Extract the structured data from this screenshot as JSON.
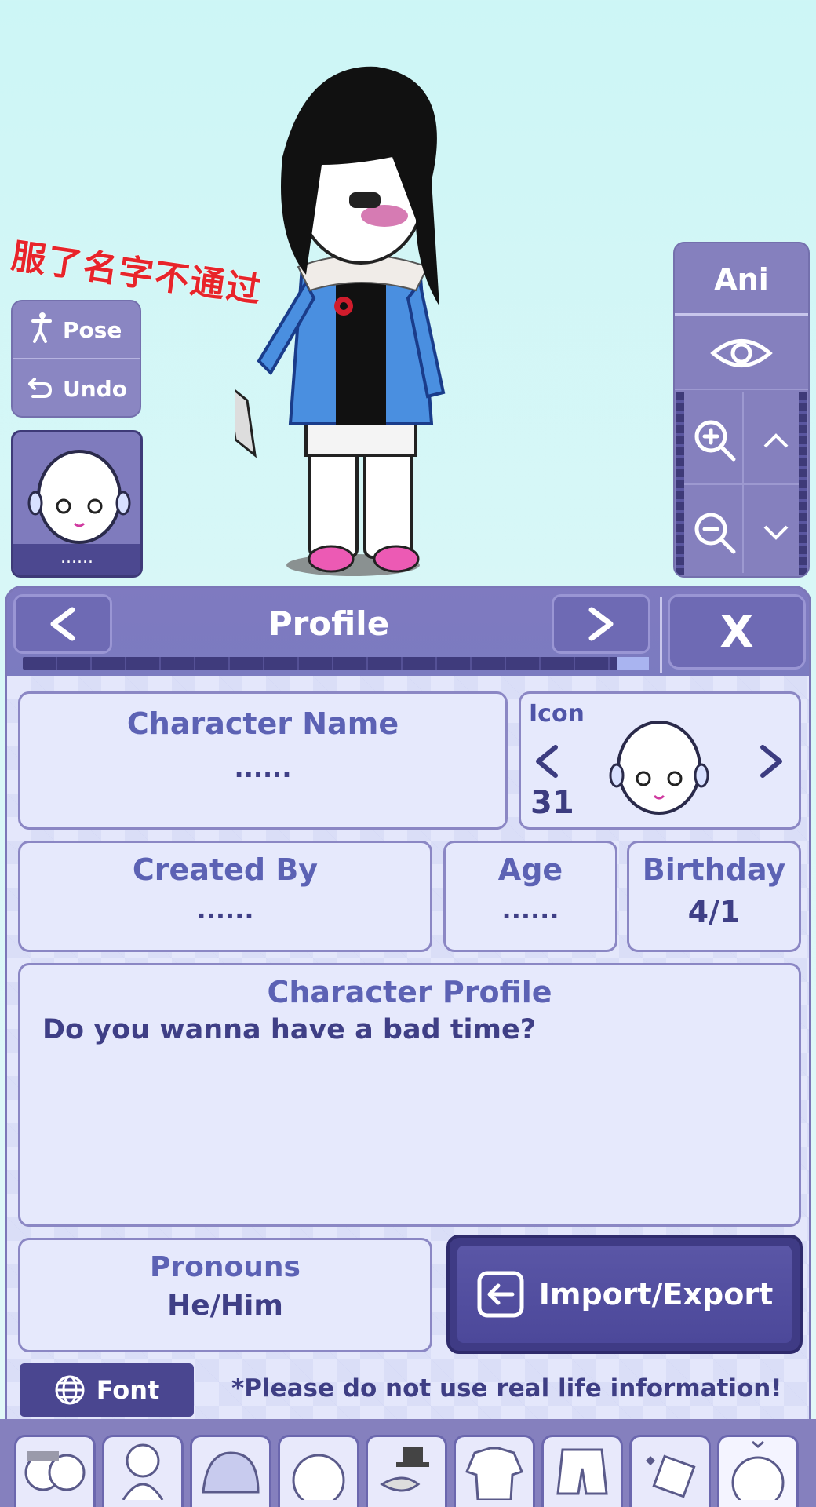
{
  "overlay": {
    "text": "服了名字不通过"
  },
  "left_controls": {
    "pose_label": "Pose",
    "undo_label": "Undo",
    "icon_card_label": "......"
  },
  "right_controls": {
    "ani_label": "Ani"
  },
  "header": {
    "title": "Profile",
    "prev": "<",
    "next": ">",
    "close": "X",
    "progress_percent": 95
  },
  "fields": {
    "character_name": {
      "title": "Character Name",
      "value": "......"
    },
    "icon": {
      "title": "Icon",
      "number": "31",
      "prev": "<",
      "next": ">"
    },
    "created_by": {
      "title": "Created By",
      "value": "......"
    },
    "age": {
      "title": "Age",
      "value": "......"
    },
    "birthday": {
      "title": "Birthday",
      "value": "4/1"
    },
    "character_profile": {
      "title": "Character Profile",
      "value": "Do you wanna have a bad time?"
    },
    "pronouns": {
      "title": "Pronouns",
      "value": "He/Him"
    }
  },
  "import_export_label": "Import/Export",
  "font_label": "Font",
  "notice": "*Please do not use real life information!",
  "colors": {
    "panel": "#8e89c9",
    "body": "#e4e7fb",
    "accent": "#4a4690",
    "overlay_red": "#e8242a"
  },
  "bottom_tabs": [
    "presets-icon",
    "body-icon",
    "hair-icon",
    "head-icon",
    "accessories-icon",
    "tops-icon",
    "bottoms-icon",
    "props-icon",
    "profile-icon"
  ]
}
